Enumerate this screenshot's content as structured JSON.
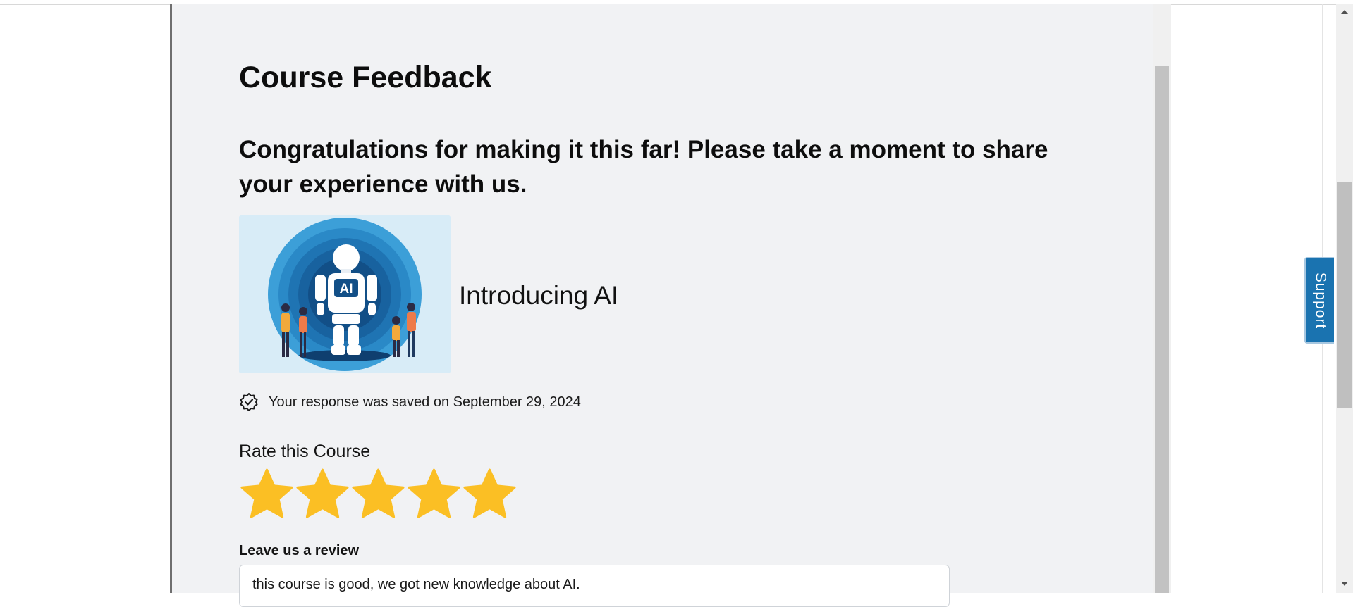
{
  "page": {
    "title": "Course Feedback",
    "congrats": "Congratulations for making it this far! Please take a moment to share your experience with us."
  },
  "course": {
    "name": "Introducing AI",
    "image_label": "AI"
  },
  "saved": {
    "text": "Your response was saved on September 29, 2024"
  },
  "rating": {
    "label": "Rate this Course",
    "value": 5,
    "max": 5,
    "star_color": "#fbbf24"
  },
  "review": {
    "label": "Leave us a review",
    "value": "this course is good, we got new knowledge about AI."
  },
  "support": {
    "label": "Support",
    "color": "#1a73b0"
  }
}
